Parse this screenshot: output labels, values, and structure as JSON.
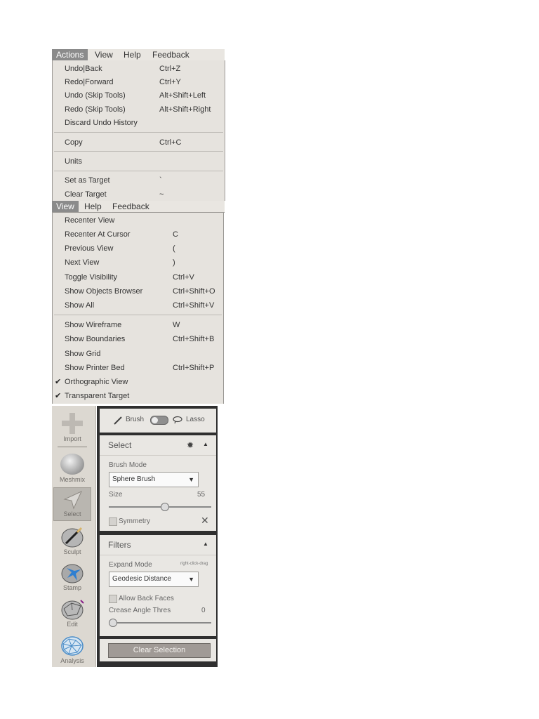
{
  "menubar1": {
    "items": [
      "Actions",
      "View",
      "Help",
      "Feedback"
    ],
    "active": "Actions"
  },
  "actions_menu": {
    "items": [
      {
        "label": "Undo|Back",
        "shortcut": "Ctrl+Z"
      },
      {
        "label": "Redo|Forward",
        "shortcut": "Ctrl+Y"
      },
      {
        "label": "Undo (Skip Tools)",
        "shortcut": "Alt+Shift+Left"
      },
      {
        "label": "Redo (Skip Tools)",
        "shortcut": "Alt+Shift+Right"
      },
      {
        "label": "Discard Undo History",
        "shortcut": ""
      },
      {
        "label": "Copy",
        "shortcut": "Ctrl+C"
      },
      {
        "label": "Units",
        "shortcut": ""
      },
      {
        "label": "Set as Target",
        "shortcut": "`"
      },
      {
        "label": "Clear Target",
        "shortcut": "~"
      }
    ]
  },
  "menubar2": {
    "items": [
      "View",
      "Help",
      "Feedback"
    ],
    "active": "View"
  },
  "view_menu": {
    "items": [
      {
        "label": "Recenter View",
        "shortcut": "",
        "checked": false
      },
      {
        "label": "Recenter At Cursor",
        "shortcut": "C",
        "checked": false
      },
      {
        "label": "Previous View",
        "shortcut": "(",
        "checked": false
      },
      {
        "label": "Next View",
        "shortcut": ")",
        "checked": false
      },
      {
        "label": "Toggle Visibility",
        "shortcut": "Ctrl+V",
        "checked": false
      },
      {
        "label": "Show Objects Browser",
        "shortcut": "Ctrl+Shift+O",
        "checked": false
      },
      {
        "label": "Show All",
        "shortcut": "Ctrl+Shift+V",
        "checked": false
      },
      {
        "label": "Show Wireframe",
        "shortcut": "W",
        "checked": false
      },
      {
        "label": "Show Boundaries",
        "shortcut": "Ctrl+Shift+B",
        "checked": false
      },
      {
        "label": "Show Grid",
        "shortcut": "",
        "checked": false
      },
      {
        "label": "Show Printer Bed",
        "shortcut": "Ctrl+Shift+P",
        "checked": false
      },
      {
        "label": "Orthographic View",
        "shortcut": "",
        "checked": true
      },
      {
        "label": "Transparent Target",
        "shortcut": "",
        "checked": true
      }
    ],
    "check_glyph": "✔"
  },
  "toolbar": {
    "tools": [
      {
        "label": "Import",
        "icon": "plus-icon"
      },
      {
        "label": "Meshmix",
        "icon": "meshmix-icon"
      },
      {
        "label": "Select",
        "icon": "select-arrow-icon",
        "active": true
      },
      {
        "label": "Sculpt",
        "icon": "sculpt-brush-icon"
      },
      {
        "label": "Stamp",
        "icon": "stamp-icon"
      },
      {
        "label": "Edit",
        "icon": "edit-icon"
      },
      {
        "label": "Analysis",
        "icon": "analysis-icon"
      }
    ]
  },
  "panel": {
    "brush_label": "Brush",
    "lasso_label": "Lasso",
    "select_title": "Select",
    "brush_mode_label": "Brush Mode",
    "brush_mode_value": "Sphere Brush",
    "size_label": "Size",
    "size_value": "55",
    "size_fraction": 0.55,
    "symmetry_label": "Symmetry",
    "filters_title": "Filters",
    "expand_mode_label": "Expand Mode",
    "expand_mode_hint": "right-click-drag",
    "expand_mode_value": "Geodesic Distance",
    "allow_back_faces_label": "Allow Back Faces",
    "crease_label": "Crease Angle Thres",
    "crease_value": "0",
    "crease_fraction": 0,
    "clear_selection_label": "Clear Selection"
  },
  "colors": {
    "menu_bg": "#e6e3de",
    "active_menu": "#8b8b8b",
    "panel_dark": "#2f2f2f",
    "button": "#a09a96"
  }
}
